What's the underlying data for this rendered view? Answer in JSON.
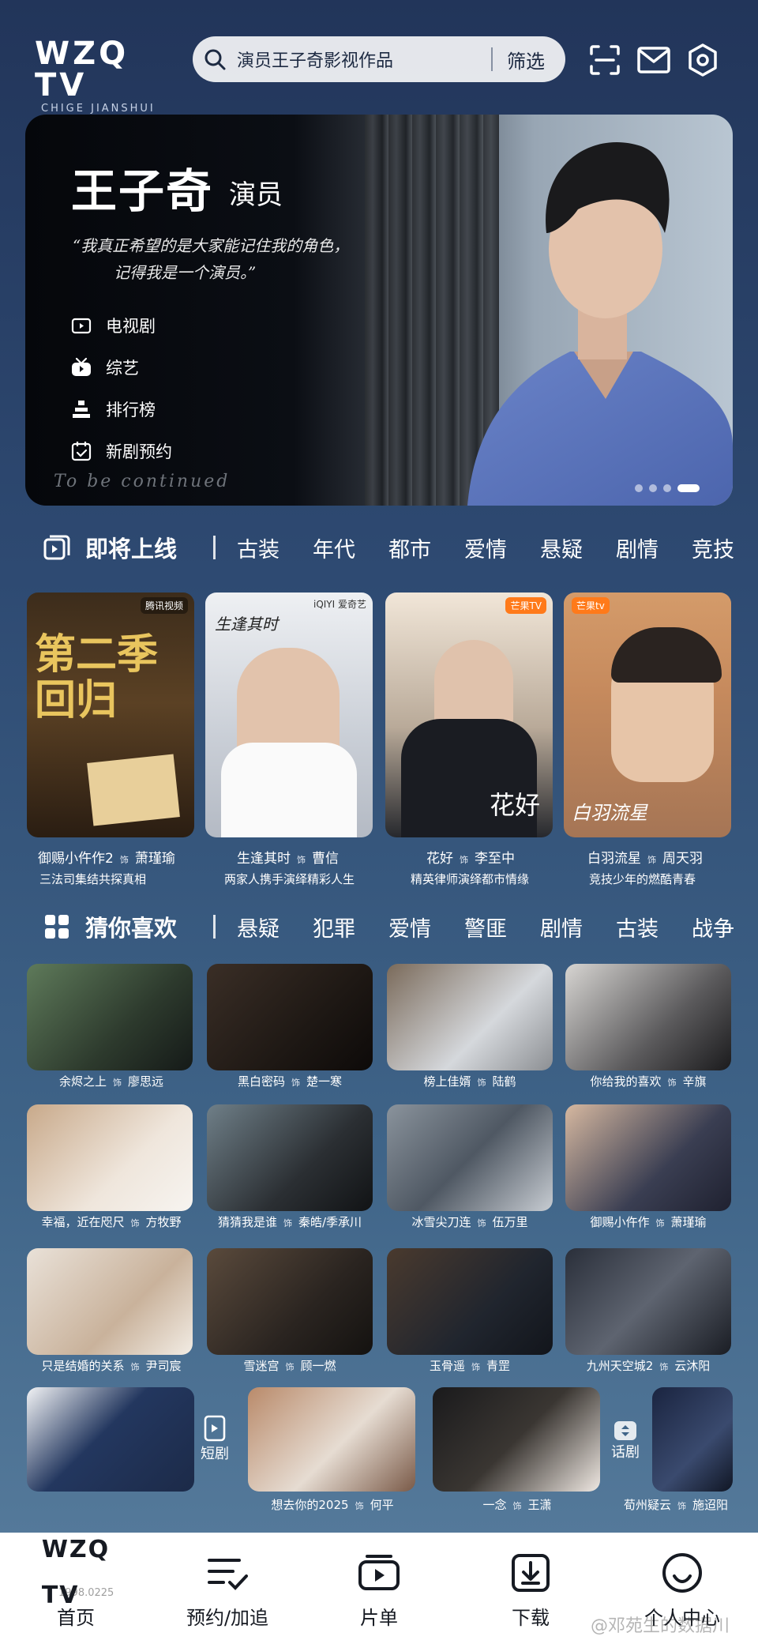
{
  "header": {
    "logo_main": "WZQ TV",
    "logo_sub": "CHIGE JIANSHUI",
    "search_text": "演员王子奇影视作品",
    "filter_label": "筛选"
  },
  "hero": {
    "name": "王子奇",
    "role": "演员",
    "quote_line1": "“我真正希望的是大家能记住我的角色，",
    "quote_line2": "记得我是一个演员。”",
    "menu": [
      {
        "label": "电视剧",
        "icon": "tv-icon"
      },
      {
        "label": "综艺",
        "icon": "variety-icon"
      },
      {
        "label": "排行榜",
        "icon": "ranking-icon"
      },
      {
        "label": "新剧预约",
        "icon": "calendar-check-icon"
      }
    ],
    "tagline": "To be continued"
  },
  "upcoming": {
    "title": "即将上线",
    "tags": [
      "古装",
      "年代",
      "都市",
      "爱情",
      "悬疑",
      "剧情",
      "竞技"
    ],
    "cards": [
      {
        "title": "御赐小仵作2",
        "role": "萧瑾瑜",
        "desc": "三法司集结共探真相",
        "badge": "腾讯视频",
        "poster_text": "第二季回归"
      },
      {
        "title": "生逢其时",
        "role": "曹信",
        "desc": "两家人携手演绎精彩人生",
        "badge": "iQIYI 爱奇艺",
        "poster_text": "生逢其时"
      },
      {
        "title": "花好",
        "role": "李至中",
        "desc": "精英律师演绎都市情缘",
        "badge": "芒果TV",
        "poster_text": "花好"
      },
      {
        "title": "白羽流星",
        "role": "周天羽",
        "desc": "竞技少年的燃酷青春",
        "badge": "芒果tv",
        "poster_text": "白羽流星"
      }
    ]
  },
  "recommend": {
    "title": "猜你喜欢",
    "tags": [
      "悬疑",
      "犯罪",
      "爱情",
      "警匪",
      "剧情",
      "古装",
      "战争"
    ],
    "items": [
      {
        "title": "余烬之上",
        "role": "廖思远"
      },
      {
        "title": "黑白密码",
        "role": "楚一寒"
      },
      {
        "title": "榜上佳婿",
        "role": "陆鹤"
      },
      {
        "title": "你给我的喜欢",
        "role": "辛旗"
      },
      {
        "title": "幸福，近在咫尺",
        "role": "方牧野"
      },
      {
        "title": "猜猜我是谁",
        "role": "秦皓/季承川"
      },
      {
        "title": "冰雪尖刀连",
        "role": "伍万里"
      },
      {
        "title": "御赐小仵作",
        "role": "萧瑾瑜"
      },
      {
        "title": "只是结婚的关系",
        "role": "尹司宸"
      },
      {
        "title": "雪迷宫",
        "role": "顾一燃"
      },
      {
        "title": "玉骨遥",
        "role": "青罡"
      },
      {
        "title": "九州天空城2",
        "role": "云沐阳"
      }
    ],
    "last_row": [
      {
        "title": "想去你的2025",
        "role": "何平"
      },
      {
        "title": "一念",
        "role": "王潇"
      },
      {
        "title": "荀州疑云",
        "role": "施迢阳"
      }
    ],
    "short_drama_label": "短剧",
    "drama_label": "话剧"
  },
  "role_sep": "饰",
  "nav": {
    "logo": "WZQ TV",
    "items": [
      {
        "label": "首页"
      },
      {
        "label": "预约/加追"
      },
      {
        "label": "片单"
      },
      {
        "label": "下载"
      },
      {
        "label": "个人中心"
      }
    ]
  },
  "watermark": "@邓苑生的数据川",
  "birth": "1998.0225"
}
